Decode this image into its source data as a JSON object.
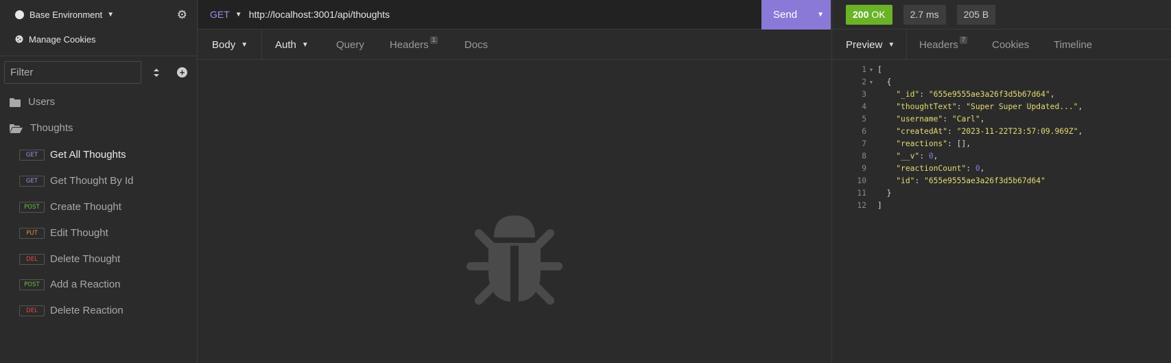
{
  "sidebar": {
    "environment": "Base Environment",
    "manage_cookies": "Manage Cookies",
    "filter_placeholder": "Filter",
    "folders": [
      {
        "name": "Users",
        "open": false
      },
      {
        "name": "Thoughts",
        "open": true
      }
    ],
    "requests": [
      {
        "method": "GET",
        "name": "Get All Thoughts",
        "active": true
      },
      {
        "method": "GET",
        "name": "Get Thought By Id",
        "active": false
      },
      {
        "method": "POST",
        "name": "Create Thought",
        "active": false
      },
      {
        "method": "PUT",
        "name": "Edit Thought",
        "active": false
      },
      {
        "method": "DEL",
        "name": "Delete Thought",
        "active": false
      },
      {
        "method": "POST",
        "name": "Add a Reaction",
        "active": false
      },
      {
        "method": "DEL",
        "name": "Delete Reaction",
        "active": false
      }
    ]
  },
  "request": {
    "method": "GET",
    "url": "http://localhost:3001/api/thoughts",
    "send_label": "Send",
    "tabs": {
      "body": "Body",
      "auth": "Auth",
      "query": "Query",
      "headers": "Headers",
      "headers_count": "1",
      "docs": "Docs"
    }
  },
  "response": {
    "status_code": "200",
    "status_text": "OK",
    "time": "2.7 ms",
    "size": "205 B",
    "tabs": {
      "preview": "Preview",
      "headers": "Headers",
      "headers_count": "7",
      "cookies": "Cookies",
      "timeline": "Timeline"
    },
    "json_lines": [
      {
        "n": "1",
        "fold": true,
        "text": "["
      },
      {
        "n": "2",
        "fold": true,
        "text": "  {"
      },
      {
        "n": "3",
        "key": "_id",
        "value": "\"655e9555ae3a26f3d5b67d64\"",
        "type": "s",
        "comma": true
      },
      {
        "n": "4",
        "key": "thoughtText",
        "value": "\"Super Super Updated...\"",
        "type": "s",
        "comma": true
      },
      {
        "n": "5",
        "key": "username",
        "value": "\"Carl\"",
        "type": "s",
        "comma": true
      },
      {
        "n": "6",
        "key": "createdAt",
        "value": "\"2023-11-22T23:57:09.969Z\"",
        "type": "s",
        "comma": true
      },
      {
        "n": "7",
        "key": "reactions",
        "value": "[]",
        "type": "p",
        "comma": true
      },
      {
        "n": "8",
        "key": "__v",
        "value": "0",
        "type": "n",
        "comma": true
      },
      {
        "n": "9",
        "key": "reactionCount",
        "value": "0",
        "type": "n",
        "comma": true
      },
      {
        "n": "10",
        "key": "id",
        "value": "\"655e9555ae3a26f3d5b67d64\"",
        "type": "s",
        "comma": false
      },
      {
        "n": "11",
        "text": "  }"
      },
      {
        "n": "12",
        "text": "]"
      }
    ]
  },
  "colors": {
    "accent": "#8b79d8",
    "status_ok": "#6ab327",
    "get": "#9f8ee6",
    "post": "#66c043",
    "put": "#e68a3c",
    "delete": "#e24b43"
  }
}
